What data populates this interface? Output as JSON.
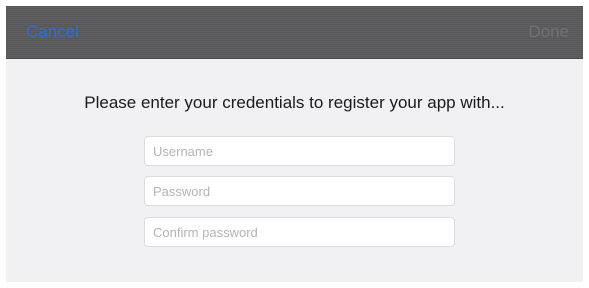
{
  "navbar": {
    "cancel_label": "Cancel",
    "done_label": "Done"
  },
  "main": {
    "prompt": "Please enter your credentials to register your app with..."
  },
  "form": {
    "username": {
      "value": "",
      "placeholder": "Username"
    },
    "password": {
      "value": "",
      "placeholder": "Password"
    },
    "confirm_password": {
      "value": "",
      "placeholder": "Confirm password"
    }
  },
  "colors": {
    "accent": "#2a6fd6",
    "navbar_bg": "#5a5a5c",
    "page_bg": "#f1f1f3"
  }
}
